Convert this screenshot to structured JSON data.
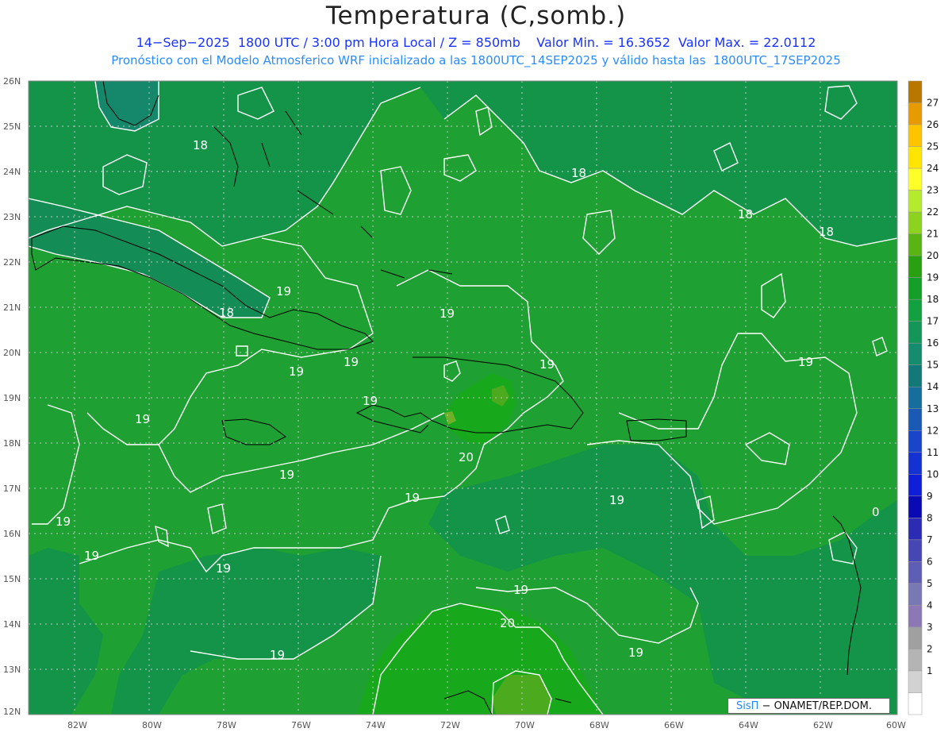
{
  "header": {
    "title": "Temperatura (C,somb.)",
    "line1": "14−Sep−2025  1800 UTC / 3:00 pm Hora Local / Z = 850mb    Valor Min. = 16.3652  Valor Max. = 22.0112",
    "line2": "Pronóstico con el Modelo Atmosferico WRF inicializado a las 1800UTC_14SEP2025 y válido hasta las  1800UTC_17SEP2025"
  },
  "map": {
    "lat_labels": [
      "26N",
      "25N",
      "24N",
      "23N",
      "22N",
      "21N",
      "20N",
      "19N",
      "18N",
      "17N",
      "16N",
      "15N",
      "14N",
      "13N",
      "12N"
    ],
    "lon_labels": [
      "82W",
      "80W",
      "78W",
      "76W",
      "74W",
      "72W",
      "70W",
      "68W",
      "66W",
      "64W",
      "62W",
      "60W"
    ],
    "contour_labels": [
      "18",
      "18",
      "18",
      "18",
      "19",
      "18",
      "19",
      "19",
      "19",
      "19",
      "19",
      "19",
      "20",
      "19",
      "19",
      "19",
      "19",
      "19",
      "19",
      "19",
      "20",
      "19",
      "0"
    ]
  },
  "colorbar": {
    "levels": [
      "27",
      "26",
      "25",
      "24",
      "23",
      "22",
      "21",
      "20",
      "19",
      "18",
      "17",
      "16",
      "15",
      "14",
      "13",
      "12",
      "11",
      "10",
      "9",
      "8",
      "7",
      "6",
      "5",
      "4",
      "3",
      "2",
      "1"
    ],
    "colors": [
      "#b87800",
      "#e89b00",
      "#ffc400",
      "#ffe600",
      "#ffff28",
      "#b4eb2d",
      "#8cd21e",
      "#5ab414",
      "#28a012",
      "#14a028",
      "#12a040",
      "#149658",
      "#168c6e",
      "#137878",
      "#156e9b",
      "#1b5ab4",
      "#1946c8",
      "#1432d2",
      "#0f1ed7",
      "#0a0ab4",
      "#2b2bb4",
      "#4646b4",
      "#5e5eb4",
      "#7878b4",
      "#8c78b4",
      "#a0a0a0",
      "#b4b4b4"
    ],
    "extra": [
      "#d2d2d2",
      "#ffffff"
    ]
  },
  "credit": {
    "brand": "SisΠ",
    "rest": " − ONAMET/REP.DOM."
  }
}
